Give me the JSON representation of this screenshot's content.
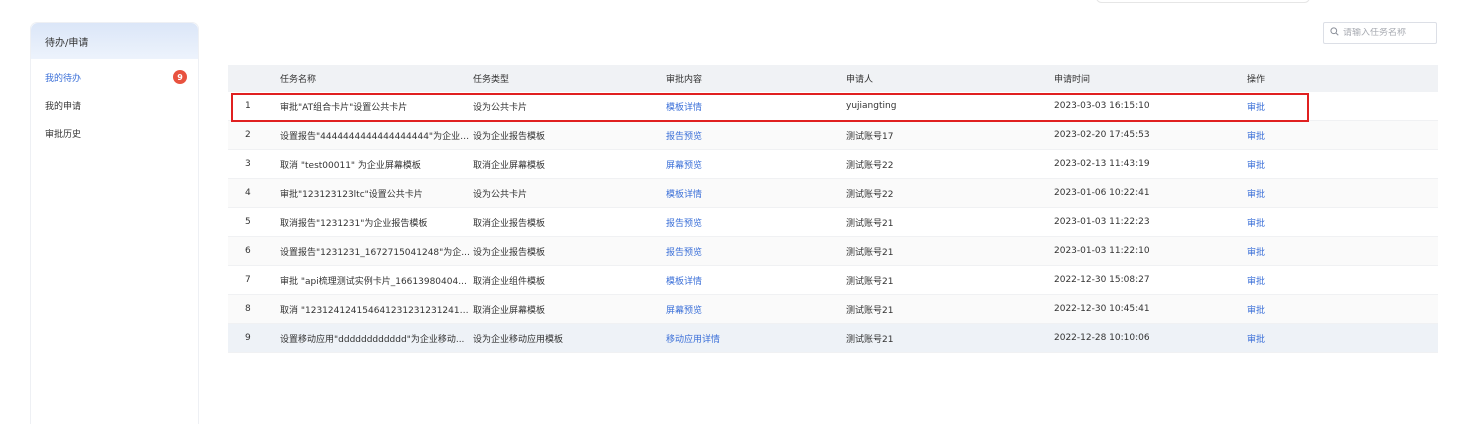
{
  "sidebar": {
    "title": "待办/申请",
    "items": [
      {
        "label": "我的待办",
        "badge": "9",
        "active": true
      },
      {
        "label": "我的申请",
        "active": false
      },
      {
        "label": "审批历史",
        "active": false
      }
    ]
  },
  "search": {
    "placeholder": "请输入任务名称",
    "value": ""
  },
  "table": {
    "columns": [
      "",
      "任务名称",
      "任务类型",
      "审批内容",
      "申请人",
      "申请时间",
      "操作"
    ],
    "rows": [
      {
        "idx": "1",
        "name": "审批\"AT组合卡片\"设置公共卡片",
        "type": "设为公共卡片",
        "content": "模板详情",
        "applicant": "yujiangting",
        "time": "2023-03-03 16:15:10",
        "action": "审批"
      },
      {
        "idx": "2",
        "name": "设置报告\"4444444444444444444\"为企业报...",
        "type": "设为企业报告模板",
        "content": "报告预览",
        "applicant": "测试账号17",
        "time": "2023-02-20 17:45:53",
        "action": "审批"
      },
      {
        "idx": "3",
        "name": "取消 \"test00011\" 为企业屏幕模板",
        "type": "取消企业屏幕模板",
        "content": "屏幕预览",
        "applicant": "测试账号22",
        "time": "2023-02-13 11:43:19",
        "action": "审批"
      },
      {
        "idx": "4",
        "name": "审批\"123123123ltc\"设置公共卡片",
        "type": "设为公共卡片",
        "content": "模板详情",
        "applicant": "测试账号22",
        "time": "2023-01-06 10:22:41",
        "action": "审批"
      },
      {
        "idx": "5",
        "name": "取消报告\"1231231\"为企业报告模板",
        "type": "取消企业报告模板",
        "content": "报告预览",
        "applicant": "测试账号21",
        "time": "2023-01-03 11:22:23",
        "action": "审批"
      },
      {
        "idx": "6",
        "name": "设置报告\"1231231_1672715041248\"为企...",
        "type": "设为企业报告模板",
        "content": "报告预览",
        "applicant": "测试账号21",
        "time": "2023-01-03 11:22:10",
        "action": "审批"
      },
      {
        "idx": "7",
        "name": "审批 \"api梳理测试实例卡片_16613980404...",
        "type": "取消企业组件模板",
        "content": "模板详情",
        "applicant": "测试账号21",
        "time": "2022-12-30 15:08:27",
        "action": "审批"
      },
      {
        "idx": "8",
        "name": "取消 \"1231241241546412312312312412...",
        "type": "取消企业屏幕模板",
        "content": "屏幕预览",
        "applicant": "测试账号21",
        "time": "2022-12-30 10:45:41",
        "action": "审批"
      },
      {
        "idx": "9",
        "name": "设置移动应用\"dddddddddddd\"为企业移动...",
        "type": "设为企业移动应用模板",
        "content": "移动应用详情",
        "applicant": "测试账号21",
        "time": "2022-12-28 10:10:06",
        "action": "审批"
      }
    ]
  },
  "colors": {
    "accent": "#3a6fd8",
    "badge": "#e8523f",
    "highlight": "#e02020"
  }
}
